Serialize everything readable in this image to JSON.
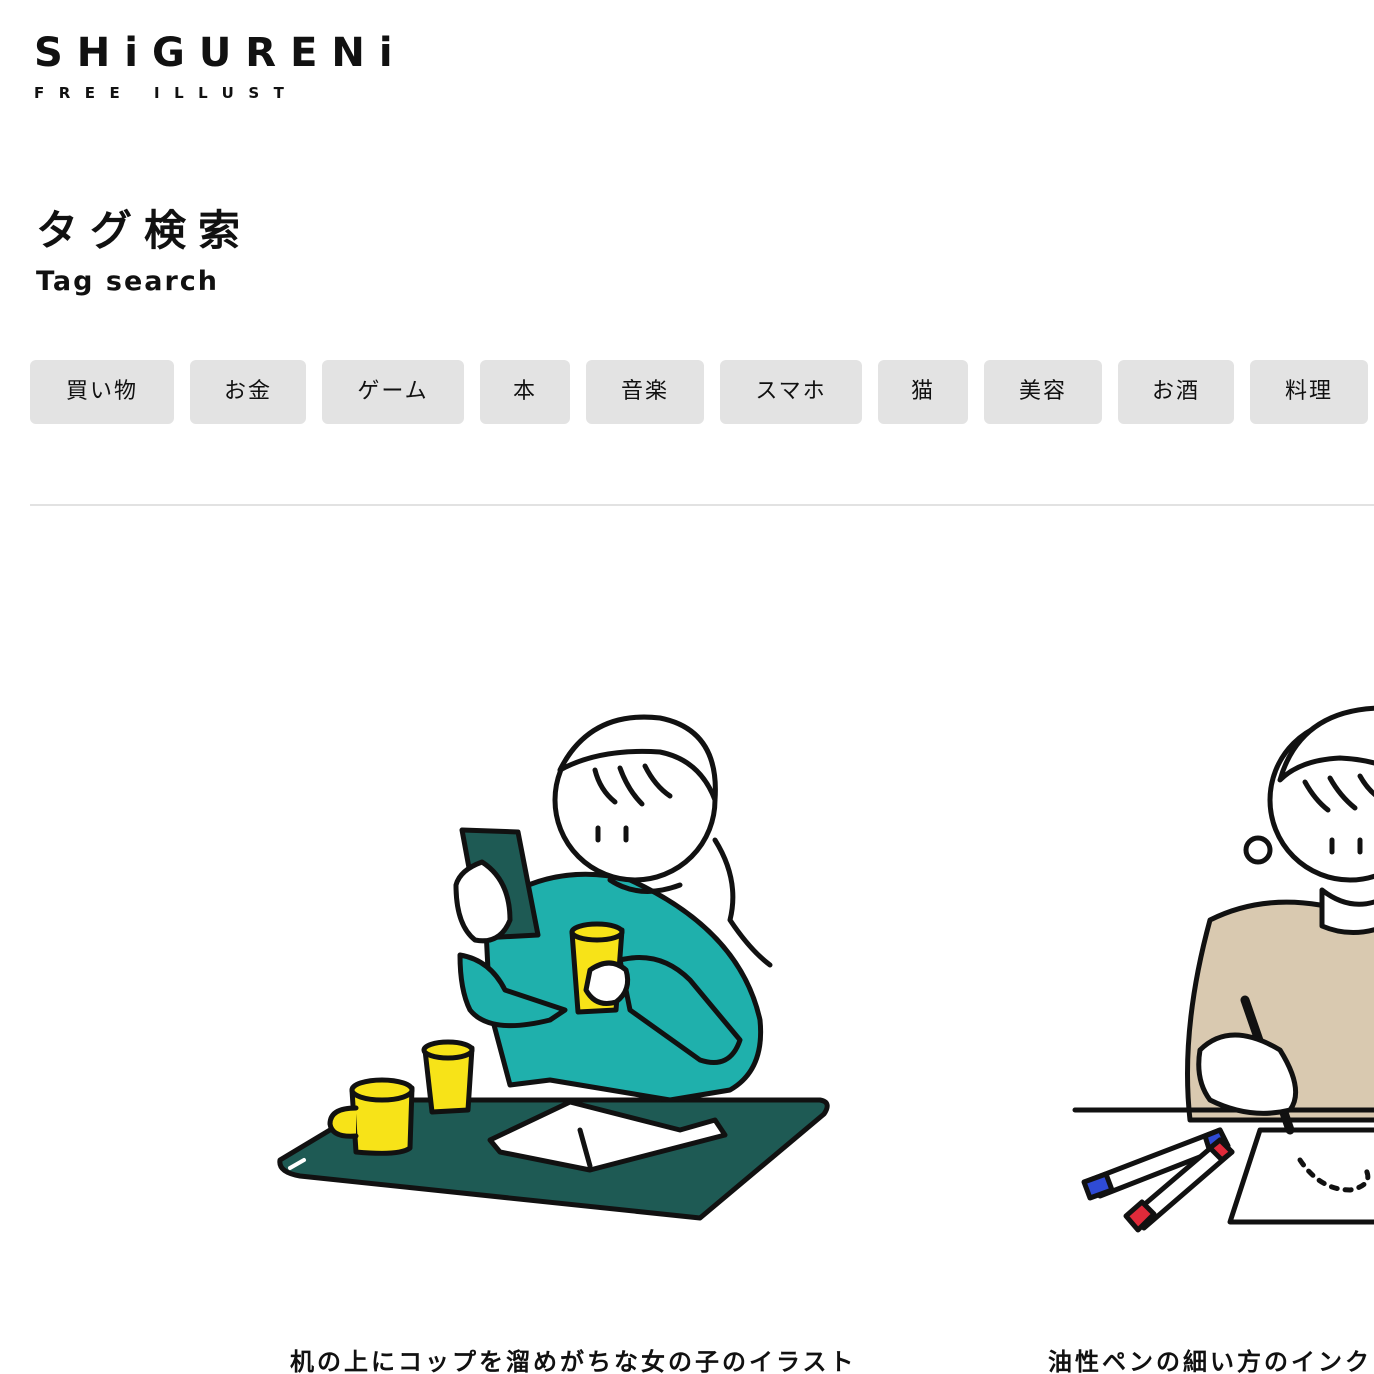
{
  "logo": {
    "name": "SHiGURENi",
    "sub": "FREE ILLUST"
  },
  "heading": {
    "jp": "タグ検索",
    "en": "Tag search"
  },
  "tags": [
    "買い物",
    "お金",
    "ゲーム",
    "本",
    "音楽",
    "スマホ",
    "猫",
    "美容",
    "お酒",
    "料理"
  ],
  "cards": [
    {
      "title": "机の上にコップを溜めがちな女の子のイラスト"
    },
    {
      "title": "油性ペンの細い方のインク"
    }
  ],
  "colors": {
    "tag_bg": "#e3e3e3",
    "teal": "#1fb0ac",
    "desk": "#1e5a54",
    "yellow": "#f7e318",
    "beige": "#d9c9b0",
    "marker_blue": "#2f4bd6",
    "marker_red": "#e02a3a"
  }
}
